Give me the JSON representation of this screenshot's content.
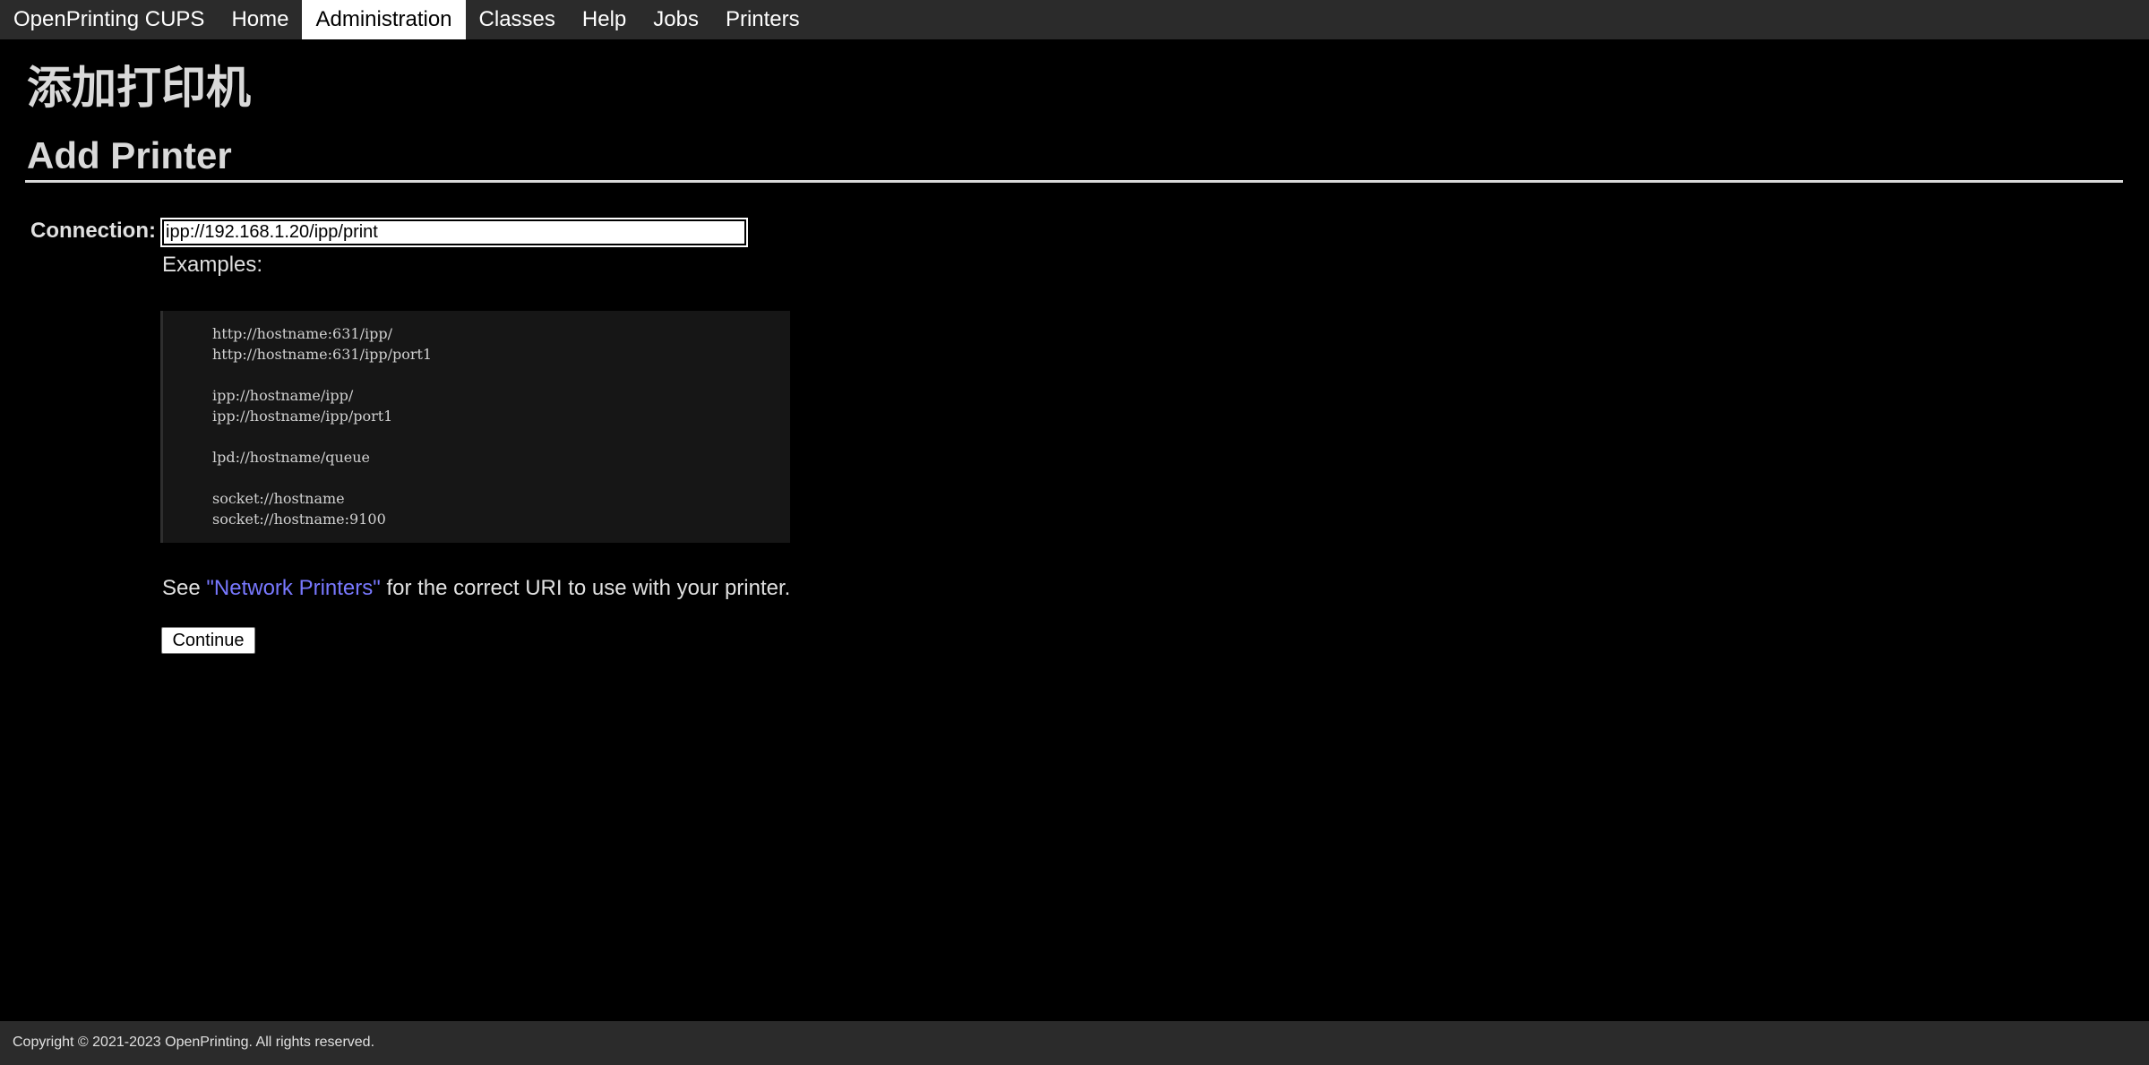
{
  "nav": {
    "brand": "OpenPrinting CUPS",
    "items": [
      {
        "label": "Home"
      },
      {
        "label": "Administration",
        "active": true
      },
      {
        "label": "Classes"
      },
      {
        "label": "Help"
      },
      {
        "label": "Jobs"
      },
      {
        "label": "Printers"
      }
    ]
  },
  "page": {
    "title_cn": "添加打印机",
    "title_en": "Add Printer"
  },
  "form": {
    "connection_label": "Connection:",
    "connection_value": "ipp://192.168.1.20/ipp/print",
    "examples_label": "Examples:",
    "examples": [
      "http://hostname:631/ipp/",
      "http://hostname:631/ipp/port1",
      "ipp://hostname/ipp/",
      "ipp://hostname/ipp/port1",
      "lpd://hostname/queue",
      "socket://hostname",
      "socket://hostname:9100"
    ],
    "see_prefix": "See ",
    "see_link": "\"Network Printers\"",
    "see_suffix": " for the correct URI to use with your printer.",
    "continue_label": "Continue"
  },
  "footer": {
    "copyright": "Copyright © 2021-2023 OpenPrinting. All rights reserved."
  },
  "colors": {
    "background": "#000000",
    "navbar": "#2b2b2b",
    "link": "#7878ff",
    "heading": "#d9d9d9"
  }
}
